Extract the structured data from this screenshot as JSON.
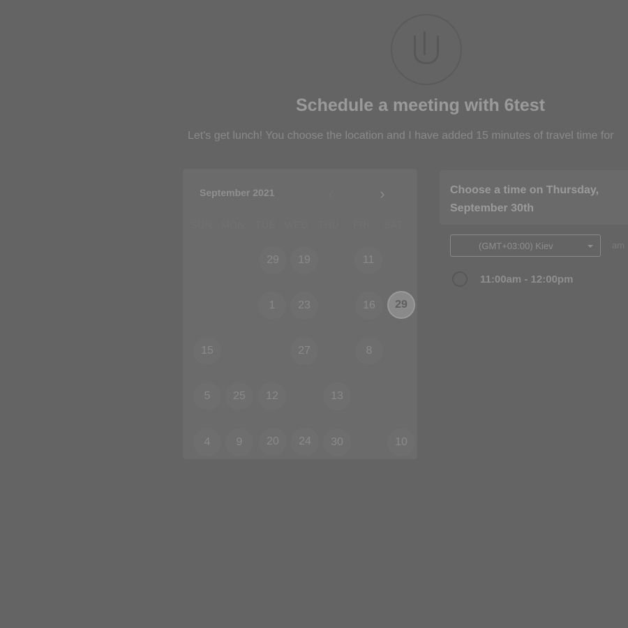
{
  "header": {
    "title": "Schedule a meeting with 6test",
    "subtitle": "Let's get lunch! You choose the location and I have added 15 minutes of travel time for"
  },
  "calendar": {
    "month_label": "September 2021",
    "prev_icon": "chevron-left-icon",
    "next_icon": "chevron-right-icon",
    "weekdays": [
      "SUN",
      "MON",
      "TUE",
      "WED",
      "THU",
      "FRI",
      "SAT"
    ],
    "days": [
      "29",
      "19",
      "11",
      "1",
      "23",
      "16",
      "29",
      "15",
      "27",
      "8",
      "5",
      "25",
      "12",
      "13",
      "4",
      "9",
      "20",
      "24",
      "30",
      "10"
    ],
    "selected_day": "29"
  },
  "time_panel": {
    "title": "Choose a time on Thursday, September 30th",
    "timezone": "(GMT+03:00) Kiev",
    "format_label": "am",
    "slot_label": "11:00am - 12:00pm"
  }
}
